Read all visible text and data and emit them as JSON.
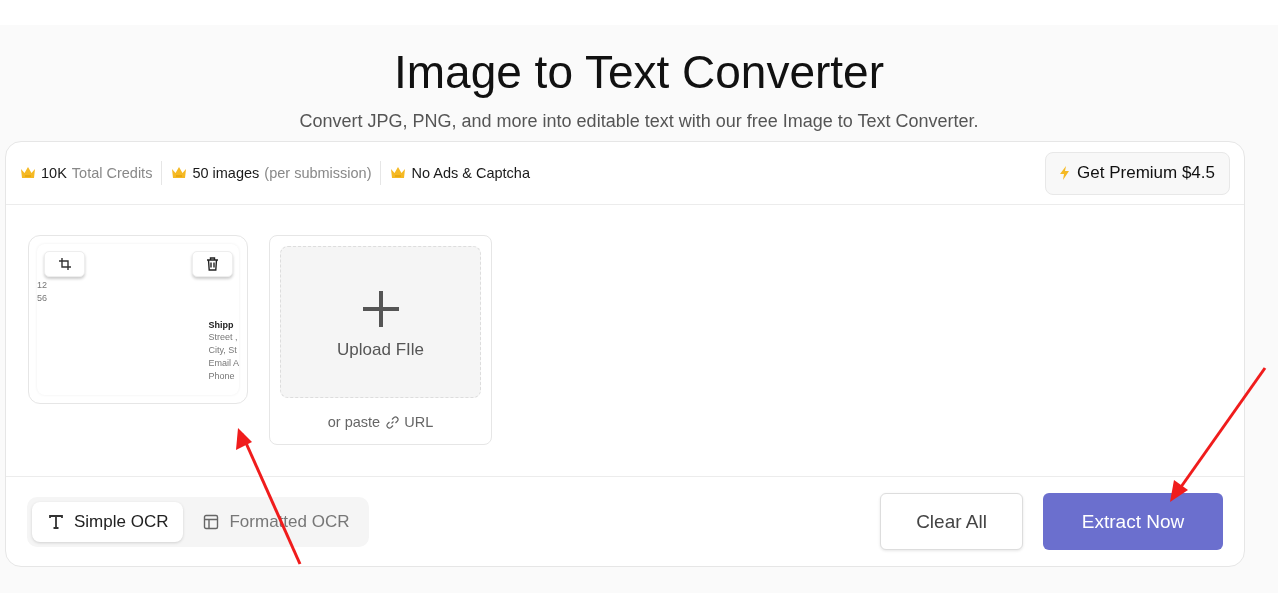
{
  "header": {
    "title": "Image to Text Converter",
    "subtitle": "Convert JPG, PNG, and more into editable text with our free Image to Text Converter."
  },
  "features": [
    {
      "value": "10K",
      "label": "Total Credits"
    },
    {
      "value": "50 images",
      "label": "(per submission)"
    },
    {
      "value": "No Ads & Captcha"
    }
  ],
  "premium_button": {
    "label": "Get Premium $4.5"
  },
  "uploaded_images": [
    {
      "preview_lines": [
        "12",
        "56"
      ],
      "preview_heading": "Shipp",
      "preview_details": [
        "Street ,",
        "City, St",
        "Email A",
        "Phone"
      ]
    }
  ],
  "upload": {
    "label": "Upload FIle",
    "paste_prefix": "or paste",
    "paste_link": "URL"
  },
  "modes": [
    {
      "label": "Simple OCR",
      "kind": "text",
      "selected": true
    },
    {
      "label": "Formatted OCR",
      "kind": "layout",
      "selected": false
    }
  ],
  "actions": [
    {
      "label": "Clear All",
      "kind": "secondary"
    },
    {
      "label": "Extract Now",
      "kind": "primary"
    }
  ],
  "annotations": [
    {
      "kind": "arrow"
    },
    {
      "kind": "arrow"
    }
  ]
}
